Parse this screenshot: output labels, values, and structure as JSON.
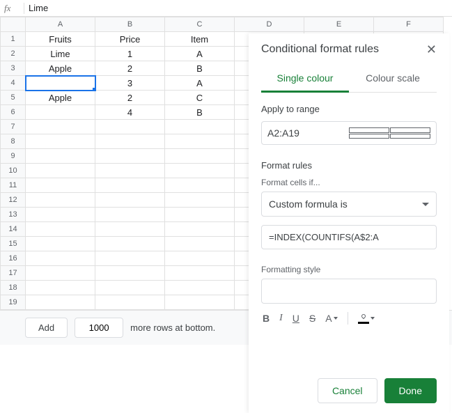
{
  "formula_bar": {
    "fx_label": "fx",
    "value": "Lime"
  },
  "columns": [
    "A",
    "B",
    "C",
    "D",
    "E",
    "F"
  ],
  "rows": [
    {
      "n": 1,
      "a": "Fruits",
      "b": "Price",
      "c": "Item"
    },
    {
      "n": 2,
      "a": "Lime",
      "b": "1",
      "c": "A"
    },
    {
      "n": 3,
      "a": "Apple",
      "b": "2",
      "c": "B"
    },
    {
      "n": 4,
      "a": "",
      "b": "3",
      "c": "A"
    },
    {
      "n": 5,
      "a": "Apple",
      "b": "2",
      "c": "C"
    },
    {
      "n": 6,
      "a": "",
      "b": "4",
      "c": "B"
    },
    {
      "n": 7
    },
    {
      "n": 8
    },
    {
      "n": 9
    },
    {
      "n": 10
    },
    {
      "n": 11
    },
    {
      "n": 12
    },
    {
      "n": 13
    },
    {
      "n": 14
    },
    {
      "n": 15
    },
    {
      "n": 16
    },
    {
      "n": 17
    },
    {
      "n": 18
    },
    {
      "n": 19
    }
  ],
  "selected_cell": "A4",
  "footer": {
    "add_label": "Add",
    "count_value": "1000",
    "suffix": "more rows at bottom."
  },
  "panel": {
    "title": "Conditional format rules",
    "tabs": {
      "single": "Single colour",
      "scale": "Colour scale"
    },
    "apply_label": "Apply to range",
    "range_value": "A2:A19",
    "format_rules_label": "Format rules",
    "format_if_label": "Format cells if...",
    "condition_value": "Custom formula is",
    "formula_value": "=INDEX(COUNTIFS(A$2:A",
    "style_label": "Formatting style",
    "buttons": {
      "cancel": "Cancel",
      "done": "Done"
    },
    "fmt": {
      "bold": "B",
      "italic": "I",
      "underline": "U",
      "strike": "S",
      "textcolor": "A"
    }
  }
}
